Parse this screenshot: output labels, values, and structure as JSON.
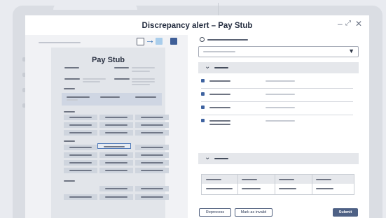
{
  "window": {
    "title": "Discrepancy alert – Pay Stub",
    "minimize_glyph": "–",
    "expand_glyph": "⤢",
    "close_glyph": "✕"
  },
  "document": {
    "title": "Pay Stub"
  },
  "toolbar": {
    "arrow_glyph": "→"
  },
  "right_panel": {
    "dropdown_arrow": "▼",
    "chevron": "⌄"
  },
  "actions": {
    "reprocess_label": "Reprocess",
    "mark_invalid_label": "Mark as invalid",
    "submit_label": "Submit"
  },
  "colors": {
    "accent": "#4e79b9",
    "primary_button": "#4e6185"
  }
}
